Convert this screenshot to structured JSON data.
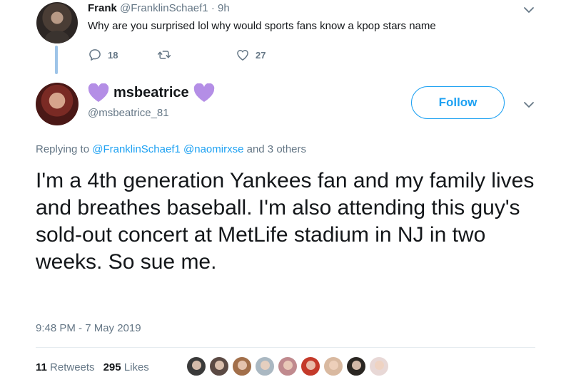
{
  "parent_tweet": {
    "name": "Frank",
    "handle_time": "@FranklinSchaef1 · 9h",
    "text": "Why are you surprised lol why would sports fans know a kpop stars name",
    "reply_count": "18",
    "retweet_count": "",
    "like_count": "27"
  },
  "main_tweet": {
    "display_name": "msbeatrice",
    "handle": "@msbeatrice_81",
    "follow_label": "Follow",
    "replying_prefix": "Replying to",
    "replying_user1": "@FranklinSchaef1",
    "replying_user2": "@naomirxse",
    "replying_suffix": "and 3 others",
    "text": "I'm a 4th generation Yankees fan and my family lives and breathes baseball. I'm also attending this guy's sold-out concert at MetLife stadium in NJ in two weeks. So sue me.",
    "timestamp": "9:48 PM - 7 May 2019",
    "retweets_count": "11",
    "retweets_label": "Retweets",
    "likes_count": "295",
    "likes_label": "Likes"
  },
  "icons": {
    "reply": "reply-icon",
    "retweet": "retweet-icon",
    "like": "heart-outline-icon",
    "caret": "chevron-down-icon",
    "name_emoji": "purple-heart-icon"
  },
  "colors": {
    "accent": "#1da1f2",
    "text_primary": "#14171a",
    "text_secondary": "#657786",
    "thread_line": "#9ec4e8",
    "purple_heart": "#b48ee6"
  },
  "liker_avatars": [
    {
      "color": "#3a3a3a"
    },
    {
      "color": "#5b4a44"
    },
    {
      "color": "#a26f4a"
    },
    {
      "color": "#aab8c2"
    },
    {
      "color": "#c08a8e"
    },
    {
      "color": "#c43a2a"
    },
    {
      "color": "#d9b9a0"
    },
    {
      "color": "#2a2622"
    },
    {
      "color": "#e8d8d6"
    }
  ]
}
